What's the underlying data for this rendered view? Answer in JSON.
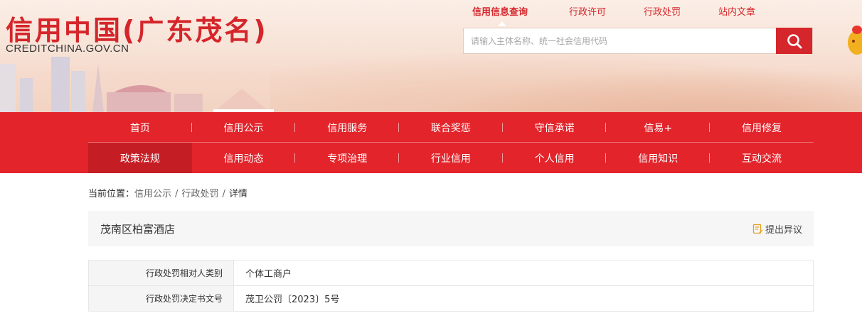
{
  "header": {
    "logo_title": "信用中国(广东茂名)",
    "logo_sub": "CREDITCHINA.GOV.CN",
    "top_links": [
      "信用信息查询",
      "行政许可",
      "行政处罚",
      "站内文章"
    ],
    "search_placeholder": "请输入主体名称、统一社会信用代码"
  },
  "nav": {
    "row1": [
      "首页",
      "信用公示",
      "信用服务",
      "联合奖惩",
      "守信承诺",
      "信易+",
      "信用修复"
    ],
    "row2": [
      "政策法规",
      "信用动态",
      "专项治理",
      "行业信用",
      "个人信用",
      "信用知识",
      "互动交流"
    ],
    "active_item": "政策法规"
  },
  "breadcrumb": {
    "label": "当前位置：",
    "items": [
      "信用公示",
      "行政处罚",
      "详情"
    ]
  },
  "detail": {
    "name": "茂南区柏富酒店",
    "objection_label": "提出异议",
    "rows": [
      {
        "key": "行政处罚相对人类别",
        "value": "个体工商户"
      },
      {
        "key": "行政处罚决定书文号",
        "value": "茂卫公罚〔2023〕5号"
      }
    ]
  },
  "colors": {
    "brand_red": "#e3242b",
    "title_red": "#d5262b"
  }
}
